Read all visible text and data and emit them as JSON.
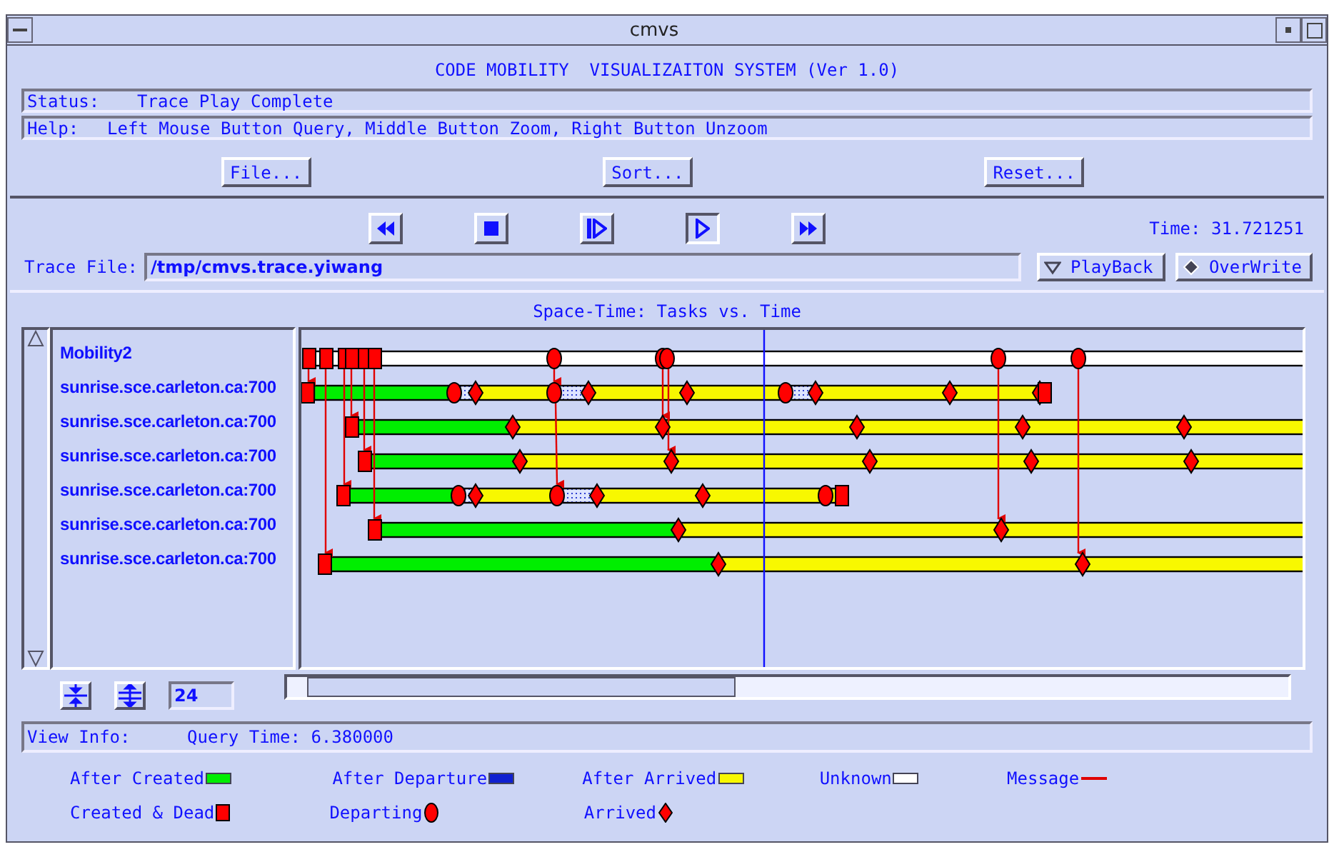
{
  "window": {
    "title": "cmvs"
  },
  "header": "CODE MOBILITY  VISUALIZAITON SYSTEM (Ver 1.0)",
  "status": {
    "label": "Status:",
    "value": "Trace Play Complete"
  },
  "help": {
    "label": "Help:",
    "value": "Left Mouse Button Query, Middle Button Zoom, Right Button Unzoom"
  },
  "buttons": [
    "File...",
    "Sort...",
    "Reset..."
  ],
  "player": {
    "controls": [
      {
        "kind": "rewind",
        "selected": false
      },
      {
        "kind": "stop",
        "selected": false
      },
      {
        "kind": "step",
        "selected": false
      },
      {
        "kind": "play",
        "selected": true
      },
      {
        "kind": "forward",
        "selected": false
      }
    ],
    "time": "Time: 31.721251"
  },
  "trace_file": {
    "label": "Trace File:",
    "value": "/tmp/cmvs.trace.yiwang"
  },
  "toggles": [
    {
      "label": "PlayBack",
      "on": false
    },
    {
      "label": "OverWrite",
      "on": true
    }
  ],
  "chart": {
    "title": "Space-Time: Tasks vs. Time",
    "rows": [
      "Mobility2",
      "sunrise.sce.carleton.ca:700",
      "sunrise.sce.carleton.ca:700",
      "sunrise.sce.carleton.ca:700",
      "sunrise.sce.carleton.ca:700",
      "sunrise.sce.carleton.ca:700",
      "sunrise.sce.carleton.ca:700"
    ],
    "zoom_value": "24"
  },
  "view_info": {
    "label": "View Info:",
    "value": "Query Time: 6.380000"
  },
  "legend": [
    [
      {
        "label": "After Created",
        "kind": "bar",
        "color": "#00ee00"
      },
      {
        "label": "After Departure",
        "kind": "bar",
        "color": "#1020d0"
      },
      {
        "label": "After Arrived",
        "kind": "bar",
        "color": "#f8f800"
      },
      {
        "label": "Unknown",
        "kind": "bar",
        "color": "#ffffff"
      },
      {
        "label": "Message",
        "kind": "line",
        "color": "#e00000"
      }
    ],
    [
      {
        "label": "Created & Dead",
        "kind": "square",
        "color": "#ff0000"
      },
      {
        "label": "Departing",
        "kind": "oval",
        "color": "#ff0000"
      },
      {
        "label": "Arrived",
        "kind": "diamond",
        "color": "#ff0000"
      }
    ]
  ]
}
